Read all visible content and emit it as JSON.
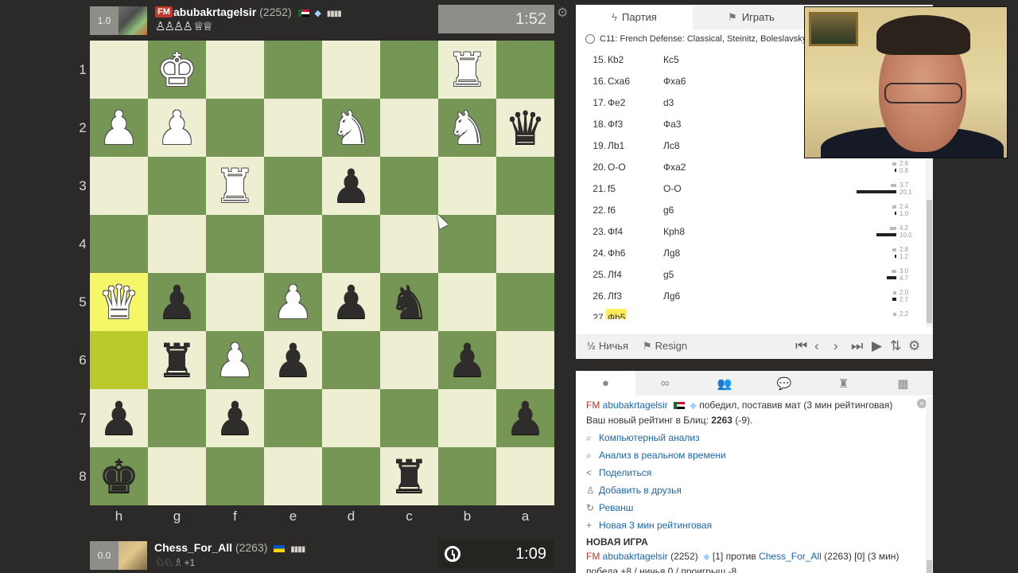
{
  "players": {
    "top": {
      "rating_box": "1.0",
      "title": "FM",
      "name": "abubakrtagelsir",
      "rating": "(2252)",
      "captured": "♙♙♙♙ ♕♕",
      "clock": "1:52"
    },
    "bottom": {
      "rating_box": "0.0",
      "name": "Chess_For_All",
      "rating": "(2263)",
      "captured": "♘♘ ♗",
      "captured_plus": "+1",
      "clock": "1:09"
    }
  },
  "board": {
    "ranks": [
      "1",
      "2",
      "3",
      "4",
      "5",
      "6",
      "7",
      "8"
    ],
    "files": [
      "h",
      "g",
      "f",
      "e",
      "d",
      "c",
      "b",
      "a"
    ],
    "rows": [
      [
        {
          "p": "",
          "c": ""
        },
        {
          "p": "♚",
          "c": "white"
        },
        {
          "p": "",
          "c": ""
        },
        {
          "p": "",
          "c": ""
        },
        {
          "p": "",
          "c": ""
        },
        {
          "p": "",
          "c": ""
        },
        {
          "p": "♜",
          "c": "white"
        },
        {
          "p": "",
          "c": ""
        }
      ],
      [
        {
          "p": "♟",
          "c": "white"
        },
        {
          "p": "♟",
          "c": "white"
        },
        {
          "p": "",
          "c": ""
        },
        {
          "p": "",
          "c": ""
        },
        {
          "p": "♞",
          "c": "white"
        },
        {
          "p": "",
          "c": ""
        },
        {
          "p": "♞",
          "c": "white"
        },
        {
          "p": "♛",
          "c": "black"
        }
      ],
      [
        {
          "p": "",
          "c": ""
        },
        {
          "p": "",
          "c": ""
        },
        {
          "p": "♜",
          "c": "white"
        },
        {
          "p": "",
          "c": ""
        },
        {
          "p": "♟",
          "c": "black"
        },
        {
          "p": "",
          "c": ""
        },
        {
          "p": "",
          "c": ""
        },
        {
          "p": "",
          "c": ""
        }
      ],
      [
        {
          "p": "",
          "c": ""
        },
        {
          "p": "",
          "c": ""
        },
        {
          "p": "",
          "c": ""
        },
        {
          "p": "",
          "c": ""
        },
        {
          "p": "",
          "c": ""
        },
        {
          "p": "",
          "c": ""
        },
        {
          "p": "",
          "c": ""
        },
        {
          "p": "",
          "c": ""
        }
      ],
      [
        {
          "p": "♛",
          "c": "white",
          "hl": true
        },
        {
          "p": "♟",
          "c": "black"
        },
        {
          "p": "",
          "c": ""
        },
        {
          "p": "♟",
          "c": "white"
        },
        {
          "p": "♟",
          "c": "black"
        },
        {
          "p": "♞",
          "c": "black"
        },
        {
          "p": "",
          "c": ""
        },
        {
          "p": "",
          "c": ""
        }
      ],
      [
        {
          "p": "",
          "c": "",
          "hl": true
        },
        {
          "p": "♜",
          "c": "black"
        },
        {
          "p": "♟",
          "c": "white"
        },
        {
          "p": "♟",
          "c": "black"
        },
        {
          "p": "",
          "c": ""
        },
        {
          "p": "",
          "c": ""
        },
        {
          "p": "♟",
          "c": "black"
        },
        {
          "p": "",
          "c": ""
        }
      ],
      [
        {
          "p": "♟",
          "c": "black"
        },
        {
          "p": "",
          "c": ""
        },
        {
          "p": "♟",
          "c": "black"
        },
        {
          "p": "",
          "c": ""
        },
        {
          "p": "",
          "c": ""
        },
        {
          "p": "",
          "c": ""
        },
        {
          "p": "",
          "c": ""
        },
        {
          "p": "♟",
          "c": "black"
        }
      ],
      [
        {
          "p": "♚",
          "c": "black"
        },
        {
          "p": "",
          "c": ""
        },
        {
          "p": "",
          "c": ""
        },
        {
          "p": "",
          "c": ""
        },
        {
          "p": "",
          "c": ""
        },
        {
          "p": "♜",
          "c": "black"
        },
        {
          "p": "",
          "c": ""
        },
        {
          "p": "",
          "c": ""
        }
      ]
    ]
  },
  "panel": {
    "tab_game": "Партия",
    "tab_play": "Играть",
    "opening": "C11: French Defense: Classical, Steinitz, Boleslavsky",
    "moves": [
      {
        "n": "15.",
        "w": "Кb2",
        "b": "Кc5"
      },
      {
        "n": "16.",
        "w": "Сxa6",
        "b": "Фxa6"
      },
      {
        "n": "17.",
        "w": "Фe2",
        "b": "d3"
      },
      {
        "n": "18.",
        "w": "Фf3",
        "b": "Фa3"
      },
      {
        "n": "19.",
        "w": "Лb1",
        "b": "Лc8"
      },
      {
        "n": "20.",
        "w": "O-O",
        "b": "Фxa2",
        "e1": "2.6",
        "e2": "0.8",
        "b1": 0.1,
        "b2": 0.03
      },
      {
        "n": "21.",
        "w": "f5",
        "b": "O-O",
        "e1": "3.7",
        "e2": "20.1",
        "b1": 0.15,
        "b2": 1.0
      },
      {
        "n": "22.",
        "w": "f6",
        "b": "g6",
        "e1": "2.4",
        "e2": "1.0",
        "b1": 0.1,
        "b2": 0.04
      },
      {
        "n": "23.",
        "w": "Фf4",
        "b": "Крh8",
        "e1": "4.2",
        "e2": "10.0",
        "b1": 0.17,
        "b2": 0.5
      },
      {
        "n": "24.",
        "w": "Фh6",
        "b": "Лg8",
        "e1": "2.8",
        "e2": "1.2",
        "b1": 0.11,
        "b2": 0.05
      },
      {
        "n": "25.",
        "w": "Лf4",
        "b": "g5",
        "e1": "3.0",
        "e2": "4.7",
        "b1": 0.12,
        "b2": 0.24
      },
      {
        "n": "26.",
        "w": "Лf3",
        "b": "Лg6",
        "e1": "2.0",
        "e2": "2.7",
        "b1": 0.08,
        "b2": 0.11
      },
      {
        "n": "27.",
        "w": "Фh5",
        "b": "",
        "e1": "2.2",
        "e2": "",
        "b1": 0.09,
        "b2": 0,
        "current": true
      }
    ],
    "draw_label": "Ничья",
    "resign_label": "Resign"
  },
  "chat": {
    "result": {
      "title": "FM",
      "name": "abubakrtagelsir",
      "text": "победил, поставив мат (3 мин рейтинговая)"
    },
    "rating_prefix": "Ваш новый рейтинг в Блиц:",
    "rating_value": "2263",
    "rating_delta": "(-9).",
    "actions": [
      "Компьютерный анализ",
      "Анализ в реальном времени",
      "Поделиться",
      "Добавить в друзья",
      "Реванш",
      "Новая 3 мин рейтинговая"
    ],
    "new_game_header": "НОВАЯ ИГРА",
    "new_game": {
      "title": "FM",
      "name": "abubakrtagelsir",
      "rating": "(2252)",
      "text1": "[1] против",
      "opponent": "Chess_For_All",
      "text2": "(2263) [0] (3 мин)"
    },
    "score_line": "победа +8 / ничья 0 / проигрыш -8"
  }
}
